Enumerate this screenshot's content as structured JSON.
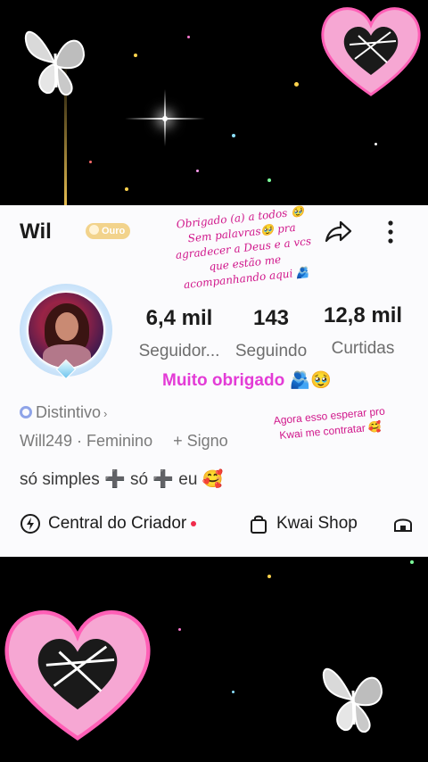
{
  "profile": {
    "name": "Wil",
    "badge": "Ouro",
    "overlay_note": "Obrigado (a) a todos 🥹 Sem palavras🥹 pra agradecer a Deus e a vcs que estão me acompanhando aqui 🫂",
    "stats": {
      "followers": {
        "value": "6,4 mil",
        "label": "Seguidor..."
      },
      "following": {
        "value": "143",
        "label": "Seguindo"
      },
      "likes": {
        "value": "12,8 mil",
        "label": "Curtidas"
      }
    },
    "thanks_text": "Muito obrigado 🫂🥹",
    "distintivo_label": "Distintivo",
    "overlay_note2": "Agora esso esperar pro Kwai me contratar 🥰",
    "username": "Will249",
    "gender": "Feminino",
    "sign": "+ Signo",
    "bio": "só simples ➕ só ➕ eu 🥰"
  },
  "tools": {
    "creator_center": "Central do Criador",
    "kwai_shop": "Kwai Shop"
  },
  "colors": {
    "accent_pink": "#e33bd6",
    "note_pink": "#d0178b",
    "badge_gold": "#f2d38c",
    "notification_red": "#f02b4b"
  },
  "icons": [
    "share-icon",
    "more-icon",
    "distintivo-icon",
    "creator-center-icon",
    "shopping-bag-icon",
    "store-icon",
    "butterfly-icon",
    "heart-icon"
  ]
}
